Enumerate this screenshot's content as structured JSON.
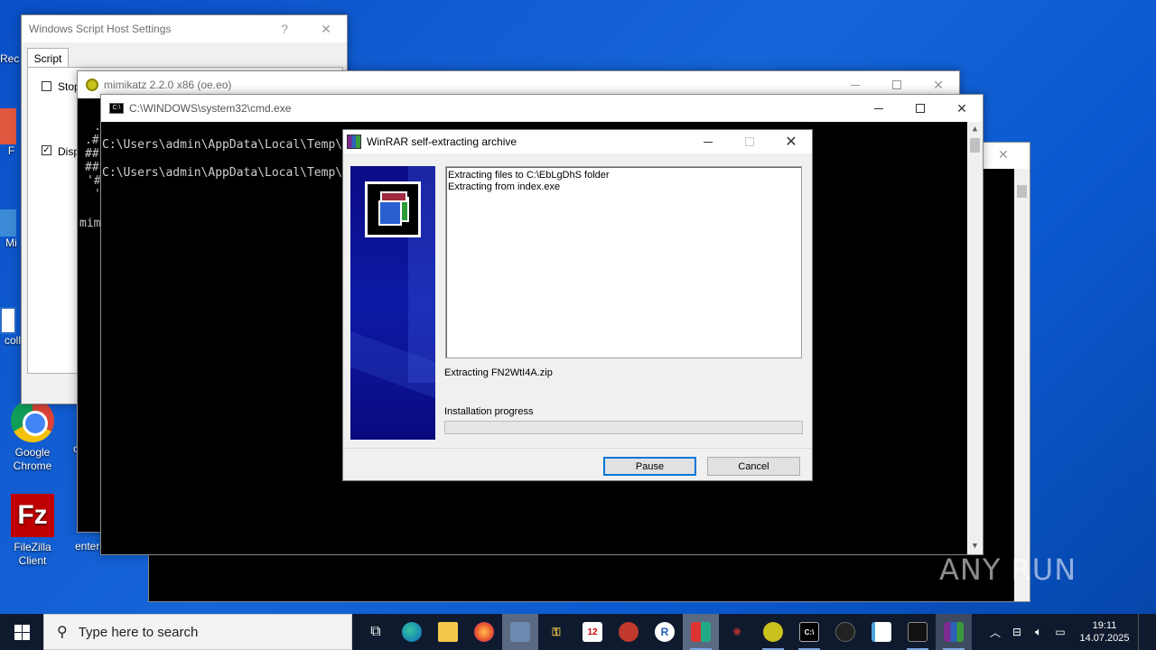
{
  "desktop": {
    "icons": [
      {
        "label": "Rec"
      },
      {
        "label": "F"
      },
      {
        "label": "Mi"
      },
      {
        "label": "coll"
      },
      {
        "label": "Google Chrome"
      },
      {
        "label": "c"
      },
      {
        "label": "FileZilla Client"
      },
      {
        "label": "enterp"
      }
    ],
    "watermark": "ANY RUN"
  },
  "wsh": {
    "title": "Windows Script Host Settings",
    "help": "?",
    "close": "✕",
    "tab": "Script",
    "stop_label": "Stop",
    "display_label": "Disp"
  },
  "mimikatz": {
    "title": "mimikatz 2.2.0 x86 (oe.eo)",
    "lines": [
      ".",
      ".#",
      "##",
      "##",
      "'#",
      "'"
    ],
    "prompt": "mimi"
  },
  "cmd": {
    "title": "C:\\WINDOWS\\system32\\cmd.exe",
    "line1": "C:\\Users\\admin\\AppData\\Local\\Temp\\",
    "line2": "C:\\Users\\admin\\AppData\\Local\\Temp\\"
  },
  "winrar": {
    "title": "WinRAR self-extracting archive",
    "log_line1": "Extracting files to C:\\EbLgDhS folder",
    "log_line2": "Extracting from index.exe",
    "current": "Extracting FN2WtI4A.zip",
    "progress_label": "Installation progress",
    "progress": 0,
    "pause_label": "Pause",
    "cancel_label": "Cancel"
  },
  "taskbar": {
    "search_placeholder": "Type here to search",
    "time": "19:11",
    "date": "14.07.2025"
  }
}
